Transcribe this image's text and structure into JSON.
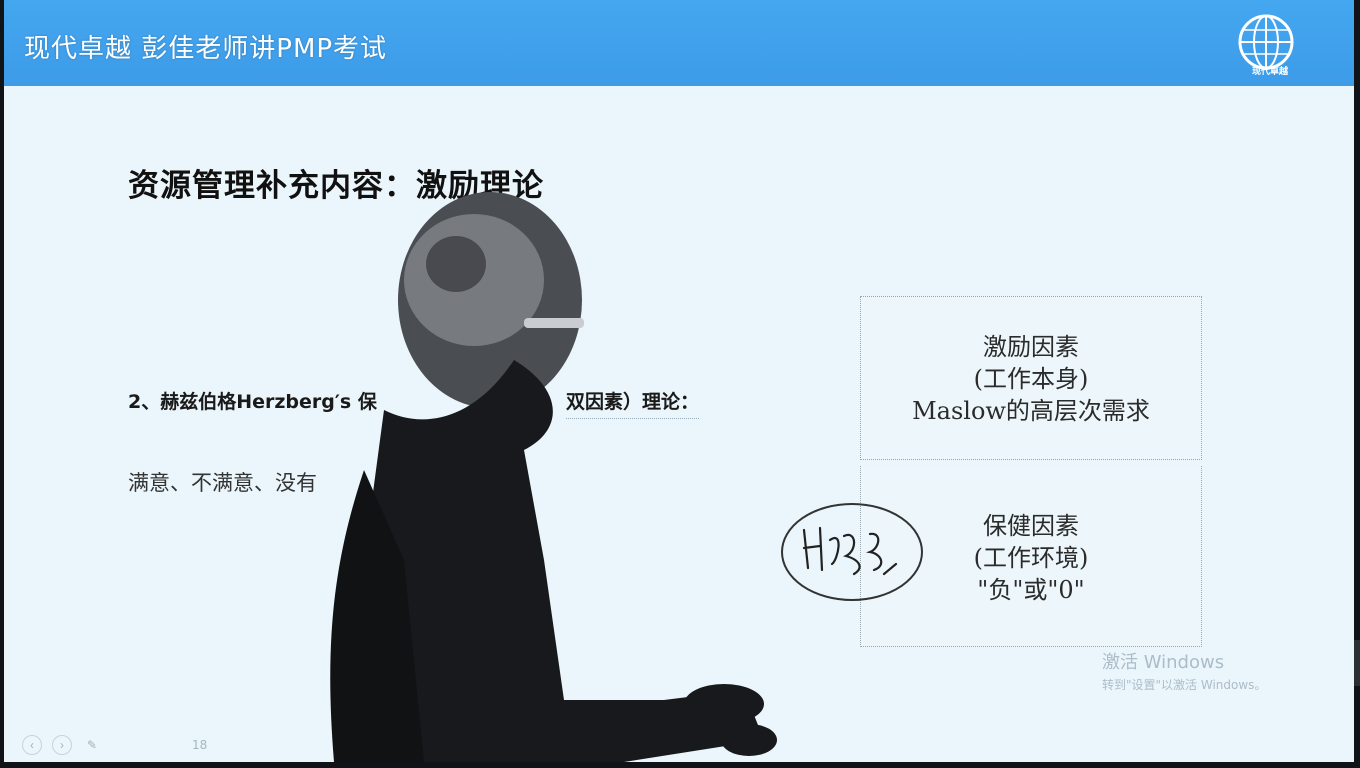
{
  "header": {
    "title": "现代卓越 彭佳老师讲PMP考试",
    "logo_caption": "现代卓越"
  },
  "slide": {
    "title": "资源管理补充内容：激励理论",
    "theory_line": "2、赫兹伯格Herzberg′s 保",
    "theory_tail": "双因素）理论：",
    "desc": "满意、不满意、没有"
  },
  "boxes": {
    "motivators": {
      "line1": "激励因素",
      "line2": "(工作本身)",
      "line3": "Maslow的高层次需求"
    },
    "hygiene": {
      "line1": "保健因素",
      "line2": "(工作环境)",
      "line3": "\"负\"或\"0\""
    }
  },
  "watermark": {
    "title": "激活 Windows",
    "subtitle": "转到\"设置\"以激活 Windows。"
  },
  "toolbar": {
    "page_number": "18"
  },
  "colors": {
    "header_blue": "#3d9be8",
    "slide_bg": "#eaf6fb"
  },
  "icons": [
    "globe-logo-icon",
    "prev-icon",
    "next-icon",
    "pen-icon"
  ]
}
